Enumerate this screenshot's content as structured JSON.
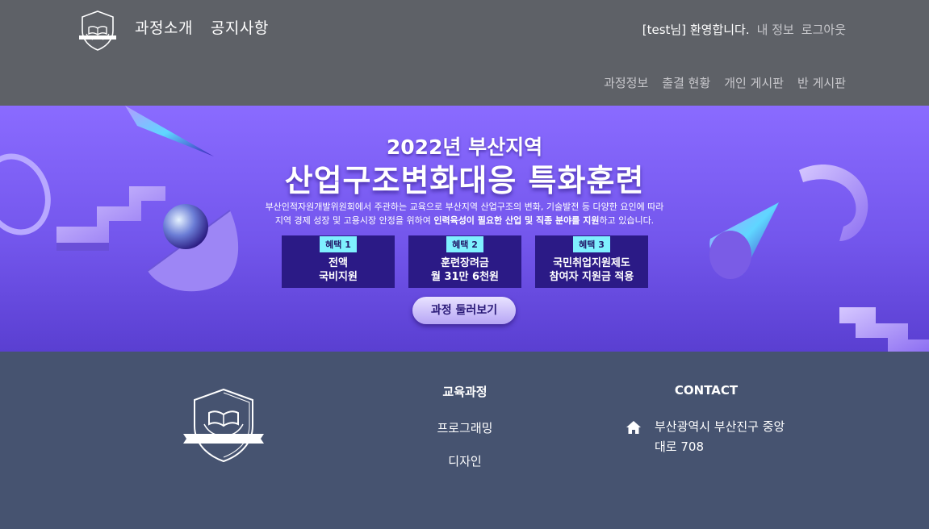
{
  "header": {
    "nav": [
      {
        "label": "과정소개"
      },
      {
        "label": "공지사항"
      }
    ],
    "user": {
      "welcome": "[test님] 환영합니다.",
      "my_info": "내 정보",
      "logout": "로그아웃"
    },
    "sub_nav": [
      {
        "label": "과정정보"
      },
      {
        "label": "출결 현황"
      },
      {
        "label": "개인 게시판"
      },
      {
        "label": "반 게시판"
      }
    ]
  },
  "banner": {
    "year_region": "2022년 부산지역",
    "title": "산업구조변화대응 특화훈련",
    "desc_line1": "부산인적자원개발위원회에서 주관하는 교육으로 부산지역 산업구조의 변화, 기술발전 등 다양한 요인에 따라",
    "desc_line2_a": "지역 경제 성장 및 고용시장 안정을 위하여 ",
    "desc_line2_b": "인력육성이 필요한 산업 및 직종 분야를 지원",
    "desc_line2_c": "하고 있습니다.",
    "benefits": [
      {
        "tag": "혜택 1",
        "text": "전액\n국비지원"
      },
      {
        "tag": "혜택 2",
        "text": "훈련장려금\n월 31만 6천원"
      },
      {
        "tag": "혜택 3",
        "text": "국민취업지원제도\n참여자 지원금 적용"
      }
    ],
    "button": "과정 둘러보기"
  },
  "footer": {
    "edu_title": "교육과정",
    "edu_links": [
      {
        "label": "프로그래밍"
      },
      {
        "label": "디자인"
      }
    ],
    "contact_title": "CONTACT",
    "address": "부산광역시 부산진구 중앙대로 708"
  },
  "colors": {
    "header_bg": "#5e6167",
    "footer_bg": "#465370",
    "banner_purple": "#7356ec",
    "benefit_box": "#2b1a86",
    "benefit_tag": "#7ff0ff"
  },
  "icons": {
    "logo": "shield-book-logo-icon",
    "address": "home-icon"
  }
}
